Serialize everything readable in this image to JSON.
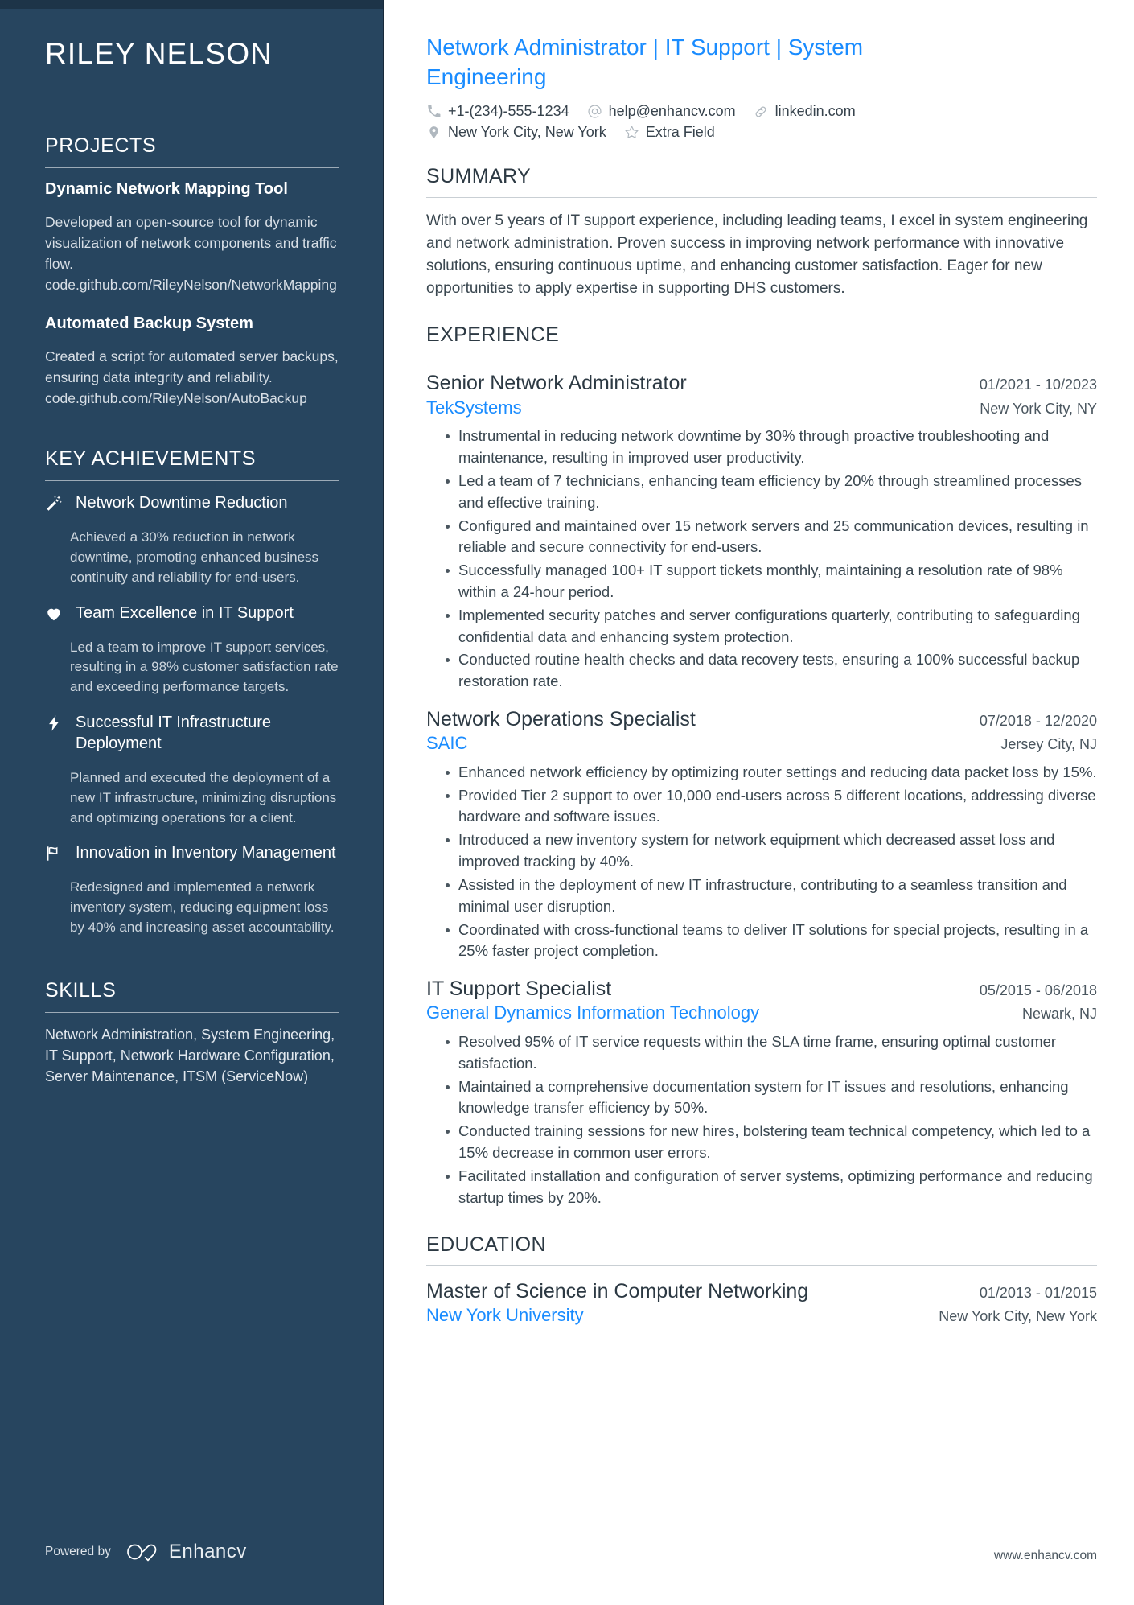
{
  "colors": {
    "sidebar_bg": "#27455f",
    "sidebar_top_band": "#1d3448",
    "accent_blue": "#1a8cff",
    "body_text": "#3a4750",
    "heading_text": "#2c3943"
  },
  "sidebar": {
    "name": "RILEY NELSON",
    "projects": {
      "heading": "PROJECTS",
      "items": [
        {
          "title": "Dynamic Network Mapping Tool",
          "description": "Developed an open-source tool for dynamic visualization of network components and traffic flow. code.github.com/RileyNelson/NetworkMapping"
        },
        {
          "title": "Automated Backup System",
          "description": "Created a script for automated server backups, ensuring data integrity and reliability. code.github.com/RileyNelson/AutoBackup"
        }
      ]
    },
    "achievements": {
      "heading": "KEY ACHIEVEMENTS",
      "items": [
        {
          "icon": "magic-wand-icon",
          "title": "Network Downtime Reduction",
          "description": "Achieved a 30% reduction in network downtime, promoting enhanced business continuity and reliability for end-users."
        },
        {
          "icon": "heart-icon",
          "title": "Team Excellence in IT Support",
          "description": "Led a team to improve IT support services, resulting in a 98% customer satisfaction rate and exceeding performance targets."
        },
        {
          "icon": "lightning-bolt-icon",
          "title": "Successful IT Infrastructure Deployment",
          "description": "Planned and executed the deployment of a new IT infrastructure, minimizing disruptions and optimizing operations for a client."
        },
        {
          "icon": "flag-icon",
          "title": "Innovation in Inventory Management",
          "description": "Redesigned and implemented a network inventory system, reducing equipment loss by 40% and increasing asset accountability."
        }
      ]
    },
    "skills": {
      "heading": "SKILLS",
      "text": "Network Administration, System Engineering, IT Support, Network Hardware Configuration, Server Maintenance, ITSM (ServiceNow)"
    },
    "footer": {
      "powered_by": "Powered by",
      "brand": "Enhancv"
    }
  },
  "main": {
    "headline": "Network Administrator | IT Support | System Engineering",
    "contact": {
      "row1": [
        {
          "icon": "phone-icon",
          "text": "+1-(234)-555-1234"
        },
        {
          "icon": "email-at-icon",
          "text": "help@enhancv.com"
        },
        {
          "icon": "link-icon",
          "text": "linkedin.com"
        }
      ],
      "row2": [
        {
          "icon": "location-pin-icon",
          "text": "New York City, New York"
        },
        {
          "icon": "star-icon",
          "text": "Extra Field"
        }
      ]
    },
    "summary": {
      "heading": "SUMMARY",
      "text": "With over 5 years of IT support experience, including leading teams, I excel in system engineering and network administration. Proven success in improving network performance with innovative solutions, ensuring continuous uptime, and enhancing customer satisfaction. Eager for new opportunities to apply expertise in supporting DHS customers."
    },
    "experience": {
      "heading": "EXPERIENCE",
      "jobs": [
        {
          "title": "Senior Network Administrator",
          "dates": "01/2021 - 10/2023",
          "company": "TekSystems",
          "location": "New York City, NY",
          "bullets": [
            "Instrumental in reducing network downtime by 30% through proactive troubleshooting and maintenance, resulting in improved user productivity.",
            "Led a team of 7 technicians, enhancing team efficiency by 20% through streamlined processes and effective training.",
            "Configured and maintained over 15 network servers and 25 communication devices, resulting in reliable and secure connectivity for end-users.",
            "Successfully managed 100+ IT support tickets monthly, maintaining a resolution rate of 98% within a 24-hour period.",
            "Implemented security patches and server configurations quarterly, contributing to safeguarding confidential data and enhancing system protection.",
            "Conducted routine health checks and data recovery tests, ensuring a 100% successful backup restoration rate."
          ]
        },
        {
          "title": "Network Operations Specialist",
          "dates": "07/2018 - 12/2020",
          "company": "SAIC",
          "location": "Jersey City, NJ",
          "bullets": [
            "Enhanced network efficiency by optimizing router settings and reducing data packet loss by 15%.",
            "Provided Tier 2 support to over 10,000 end-users across 5 different locations, addressing diverse hardware and software issues.",
            "Introduced a new inventory system for network equipment which decreased asset loss and improved tracking by 40%.",
            "Assisted in the deployment of new IT infrastructure, contributing to a seamless transition and minimal user disruption.",
            "Coordinated with cross-functional teams to deliver IT solutions for special projects, resulting in a 25% faster project completion."
          ]
        },
        {
          "title": "IT Support Specialist",
          "dates": "05/2015 - 06/2018",
          "company": "General Dynamics Information Technology",
          "location": "Newark, NJ",
          "bullets": [
            "Resolved 95% of IT service requests within the SLA time frame, ensuring optimal customer satisfaction.",
            "Maintained a comprehensive documentation system for IT issues and resolutions, enhancing knowledge transfer efficiency by 50%.",
            "Conducted training sessions for new hires, bolstering team technical competency, which led to a 15% decrease in common user errors.",
            "Facilitated installation and configuration of server systems, optimizing performance and reducing startup times by 20%."
          ]
        }
      ]
    },
    "education": {
      "heading": "EDUCATION",
      "entries": [
        {
          "degree": "Master of Science in Computer Networking",
          "dates": "01/2013 - 01/2015",
          "school": "New York University",
          "location": "New York City, New York"
        }
      ]
    },
    "footer": {
      "website": "www.enhancv.com"
    }
  }
}
